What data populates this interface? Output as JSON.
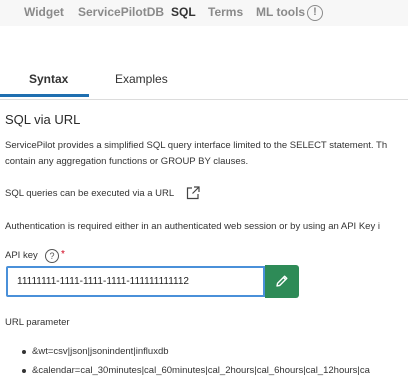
{
  "topnav": {
    "items": [
      "Widget",
      "ServicePilotDB",
      "SQL",
      "Terms",
      "ML tools"
    ],
    "active": "SQL",
    "info_icon": "!"
  },
  "tabs": [
    "Syntax",
    "Examples"
  ],
  "active_tab": "Syntax",
  "title": "SQL via URL",
  "paragraphs": {
    "intro_line1": "ServicePilot provides a simplified SQL query interface limited to the SELECT statement. Th",
    "intro_line2": "contain any aggregation functions or GROUP BY clauses.",
    "via_url": "SQL queries can be executed via a URL",
    "auth": "Authentication is required either in an authenticated web session or by using an API Key i"
  },
  "api_key": {
    "label": "API key",
    "help_icon": "?",
    "required_mark": "*",
    "value": "11111111-1111-1111-1111-111111111112"
  },
  "url_parameter_label": "URL parameter",
  "url_params": [
    "&wt=csv|json|jsonindent|influxdb",
    "&calendar=cal_30minutes|cal_60minutes|cal_2hours|cal_6hours|cal_12hours|ca"
  ],
  "colors": {
    "accent": "#1f6fb0",
    "input_focus": "#4a90d9",
    "edit_button": "#2e8b57",
    "required": "#d0021b"
  }
}
